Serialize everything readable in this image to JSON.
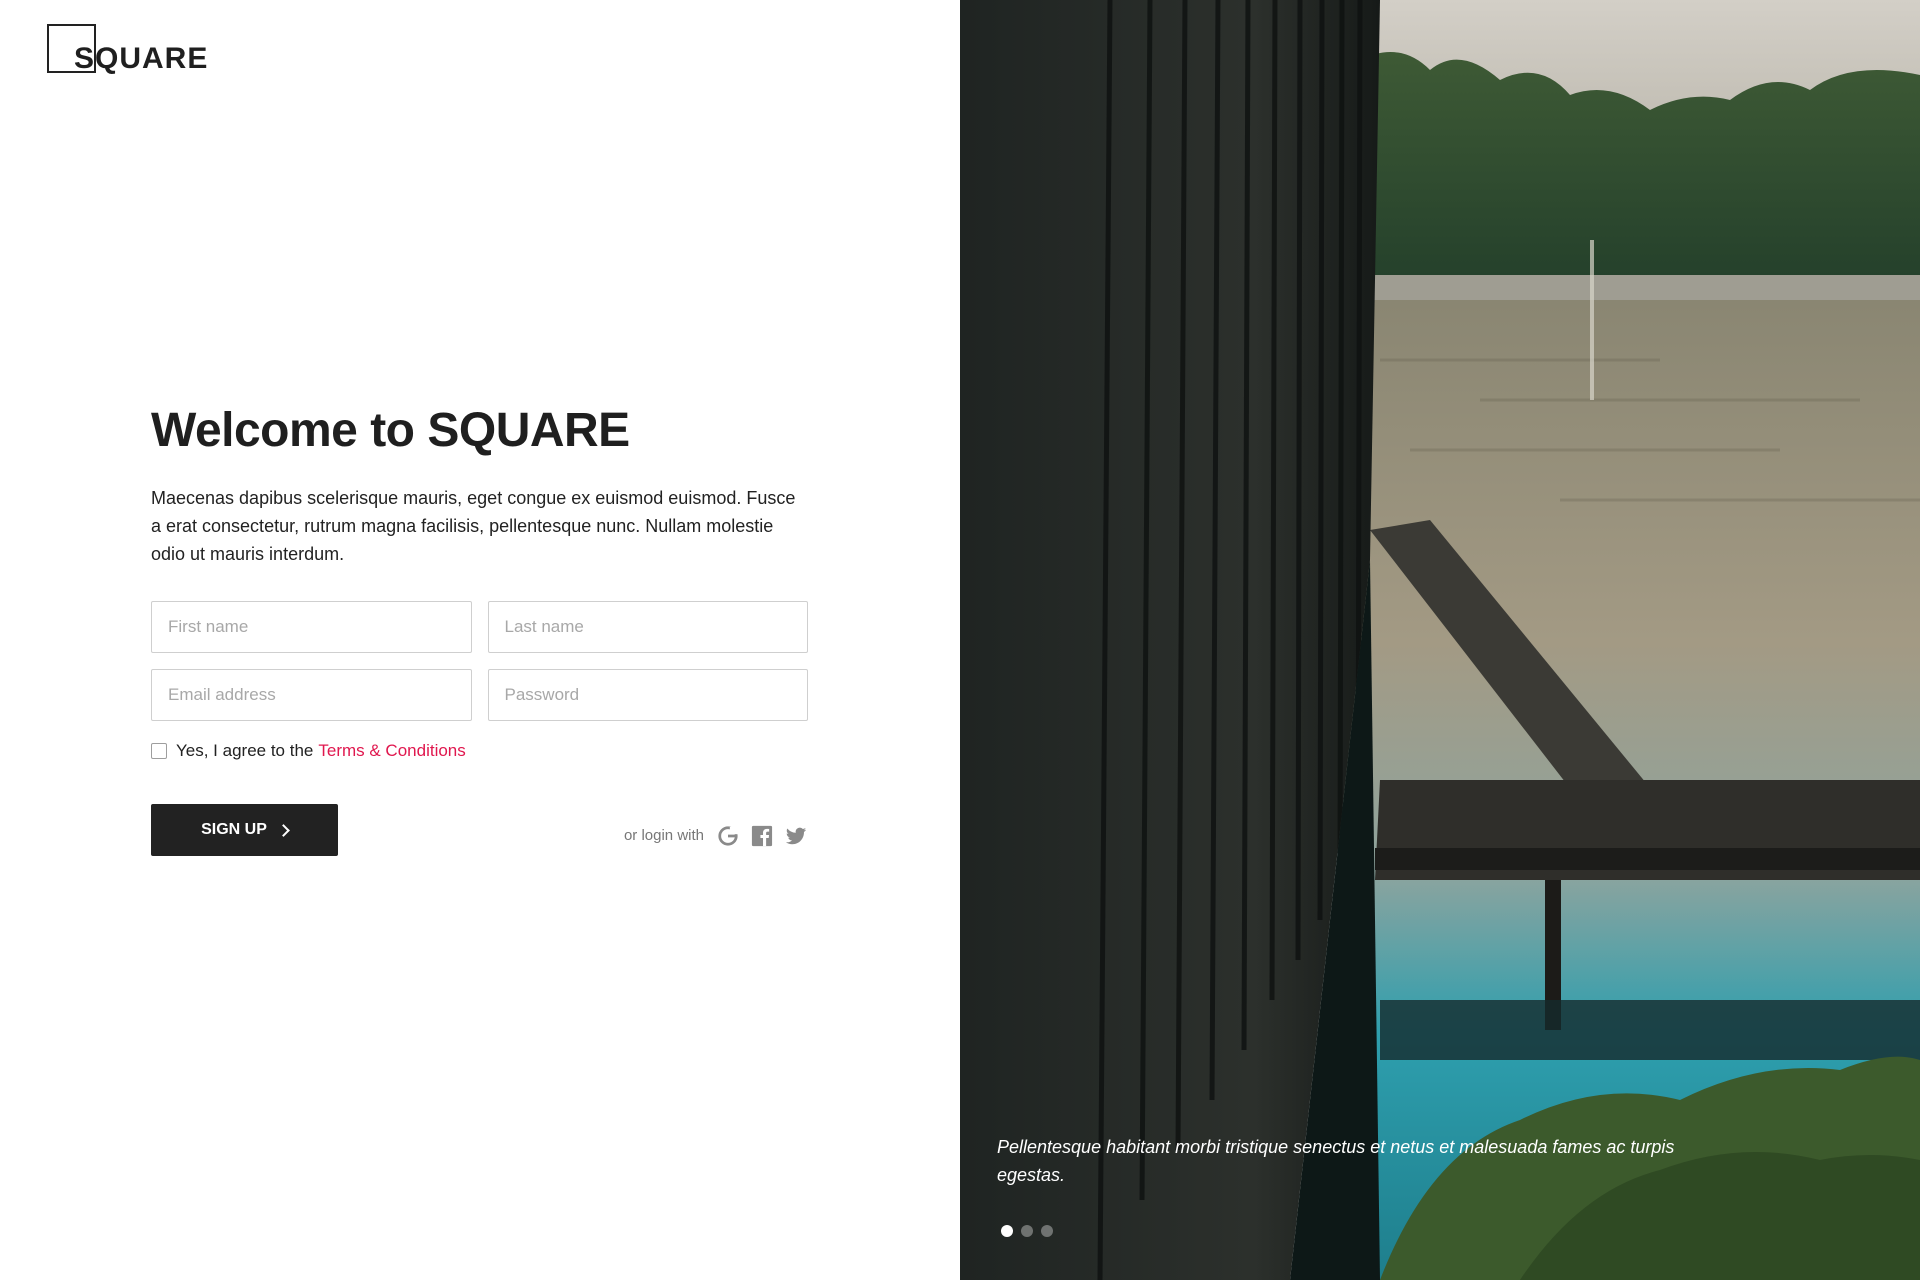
{
  "brand": {
    "logo_text": "SQUARE"
  },
  "signup": {
    "title": "Welcome to SQUARE",
    "description": "Maecenas dapibus scelerisque mauris, eget congue ex euismod euismod. Fusce a erat consectetur, rutrum magna facilisis, pellentesque nunc. Nullam molestie odio ut mauris interdum.",
    "fields": {
      "first_name": {
        "placeholder": "First name",
        "value": ""
      },
      "last_name": {
        "placeholder": "Last name",
        "value": ""
      },
      "email": {
        "placeholder": "Email address",
        "value": ""
      },
      "password": {
        "placeholder": "Password",
        "value": ""
      }
    },
    "agree_text": "Yes, I agree to the",
    "terms_link": "Terms & Conditions",
    "agree_checked": false,
    "submit_label": "SIGN UP",
    "social_label": "or login with",
    "social_icons": [
      "google-icon",
      "facebook-icon",
      "twitter-icon"
    ]
  },
  "hero": {
    "caption": "Pellentesque habitant morbi tristique senectus et netus et malesuada fames ac turpis egestas.",
    "slides_total": 3,
    "active_slide": 1
  },
  "colors": {
    "accent": "#e0174e",
    "button_bg": "#222222",
    "text_dark": "#1f1f1f"
  }
}
